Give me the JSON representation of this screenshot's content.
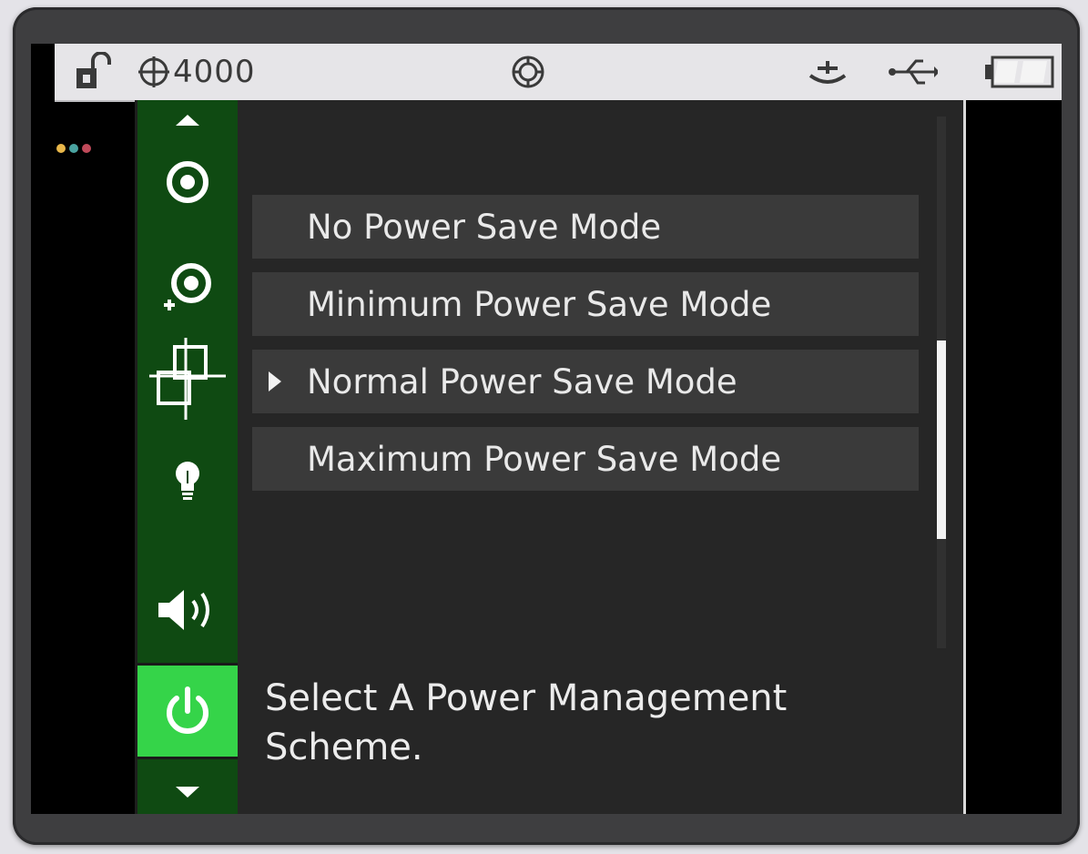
{
  "status_bar": {
    "lock_icon": "padlock-unlocked-icon",
    "crosshair_icon": "crosshair-circle-icon",
    "value": "4000",
    "target_icon": "target-circle-icon",
    "ground_icon": "ground-symbol-icon",
    "usb_icon": "usb-icon",
    "battery_icon": "battery-icon"
  },
  "indicator_dots": [
    {
      "name": "indicator-dot-yellow",
      "color": "#e8b74a"
    },
    {
      "name": "indicator-dot-teal",
      "color": "#4aa3a0"
    },
    {
      "name": "indicator-dot-red",
      "color": "#c04a5a"
    }
  ],
  "sidebar": {
    "items": [
      {
        "icon": "arrow-up-icon",
        "active": false
      },
      {
        "icon": "target-icon",
        "active": false
      },
      {
        "icon": "add-target-icon",
        "active": false
      },
      {
        "icon": "crosshair-frame-icon",
        "active": false
      },
      {
        "icon": "lightbulb-icon",
        "active": false
      },
      {
        "icon": "speaker-icon",
        "active": false
      },
      {
        "icon": "power-icon",
        "active": true
      },
      {
        "icon": "arrow-down-icon",
        "active": false
      }
    ],
    "active_color": "#35d449",
    "background": "#0f4a12"
  },
  "menu": {
    "items": [
      {
        "label": "No Power Save Mode",
        "selected": false
      },
      {
        "label": "Minimum Power Save Mode",
        "selected": false
      },
      {
        "label": "Normal Power Save Mode",
        "selected": true
      },
      {
        "label": "Maximum Power Save Mode",
        "selected": false
      }
    ]
  },
  "prompt": {
    "line1": "Select A Power Management",
    "line2": "Scheme."
  }
}
